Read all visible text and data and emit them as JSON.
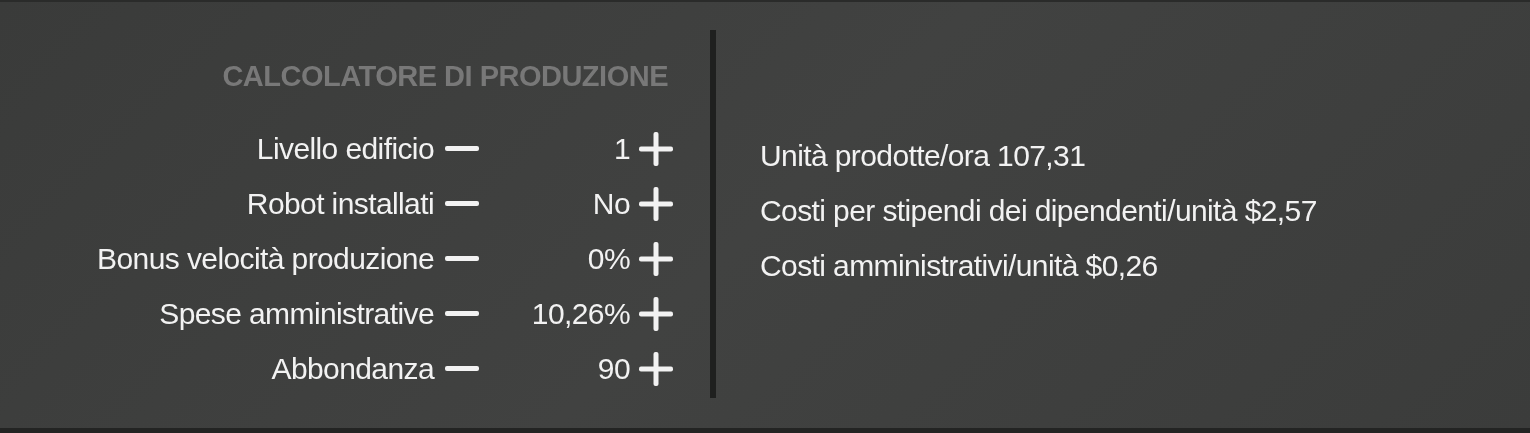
{
  "title": "CALCOLATORE DI PRODUZIONE",
  "settings": [
    {
      "label": "Livello edificio",
      "value": "1"
    },
    {
      "label": "Robot installati",
      "value": "No"
    },
    {
      "label": "Bonus velocità produzione",
      "value": "0%"
    },
    {
      "label": "Spese amministrative",
      "value": "10,26%"
    },
    {
      "label": "Abbondanza",
      "value": "90"
    }
  ],
  "results": [
    "Unità prodotte/ora 107,31",
    "Costi per stipendi dei dipendenti/unità $2,57",
    "Costi amministrativi/unità $0,26"
  ]
}
